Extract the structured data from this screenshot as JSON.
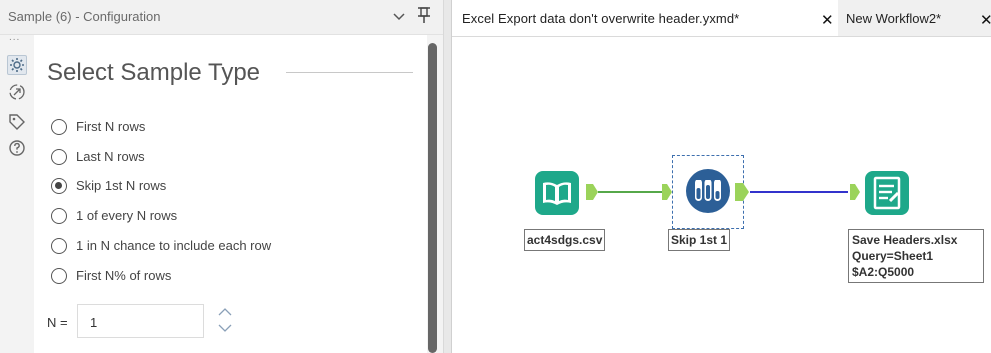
{
  "panel": {
    "title": "Sample (6) - Configuration"
  },
  "rail": {
    "dots": "...",
    "icons": [
      "config-icon",
      "connection-icon",
      "annotation-icon",
      "help-icon"
    ]
  },
  "config": {
    "section_title": "Select Sample Type",
    "options": [
      {
        "label": "First N rows",
        "checked": false
      },
      {
        "label": "Last N rows",
        "checked": false
      },
      {
        "label": "Skip 1st N rows",
        "checked": true
      },
      {
        "label": "1 of every N rows",
        "checked": false
      },
      {
        "label": "1 in N chance to include each row",
        "checked": false
      },
      {
        "label": "First N% of rows",
        "checked": false
      }
    ],
    "n_label": "N =",
    "n_value": "1"
  },
  "tabs": [
    {
      "label": "Excel Export data don't overwrite header.yxmd*",
      "active": true,
      "close": "✕"
    },
    {
      "label": "New Workflow2*",
      "active": false,
      "close": "✕"
    }
  ],
  "workflow": {
    "input_tool": {
      "label": "act4sdgs.csv"
    },
    "sample_tool": {
      "label": "Skip 1st 1"
    },
    "output_tool": {
      "label_lines": [
        "Save Headers.xlsx",
        "Query=Sheet1",
        "$A2:Q5000"
      ]
    }
  },
  "colors": {
    "input_green": "#1ea88a",
    "sample_blue": "#2c5f97",
    "output_green": "#1ea88a",
    "anchor_green": "#9bd35a",
    "link_green": "#56a84a",
    "link_blue": "#3333cc",
    "scrollbar": "#666666"
  }
}
